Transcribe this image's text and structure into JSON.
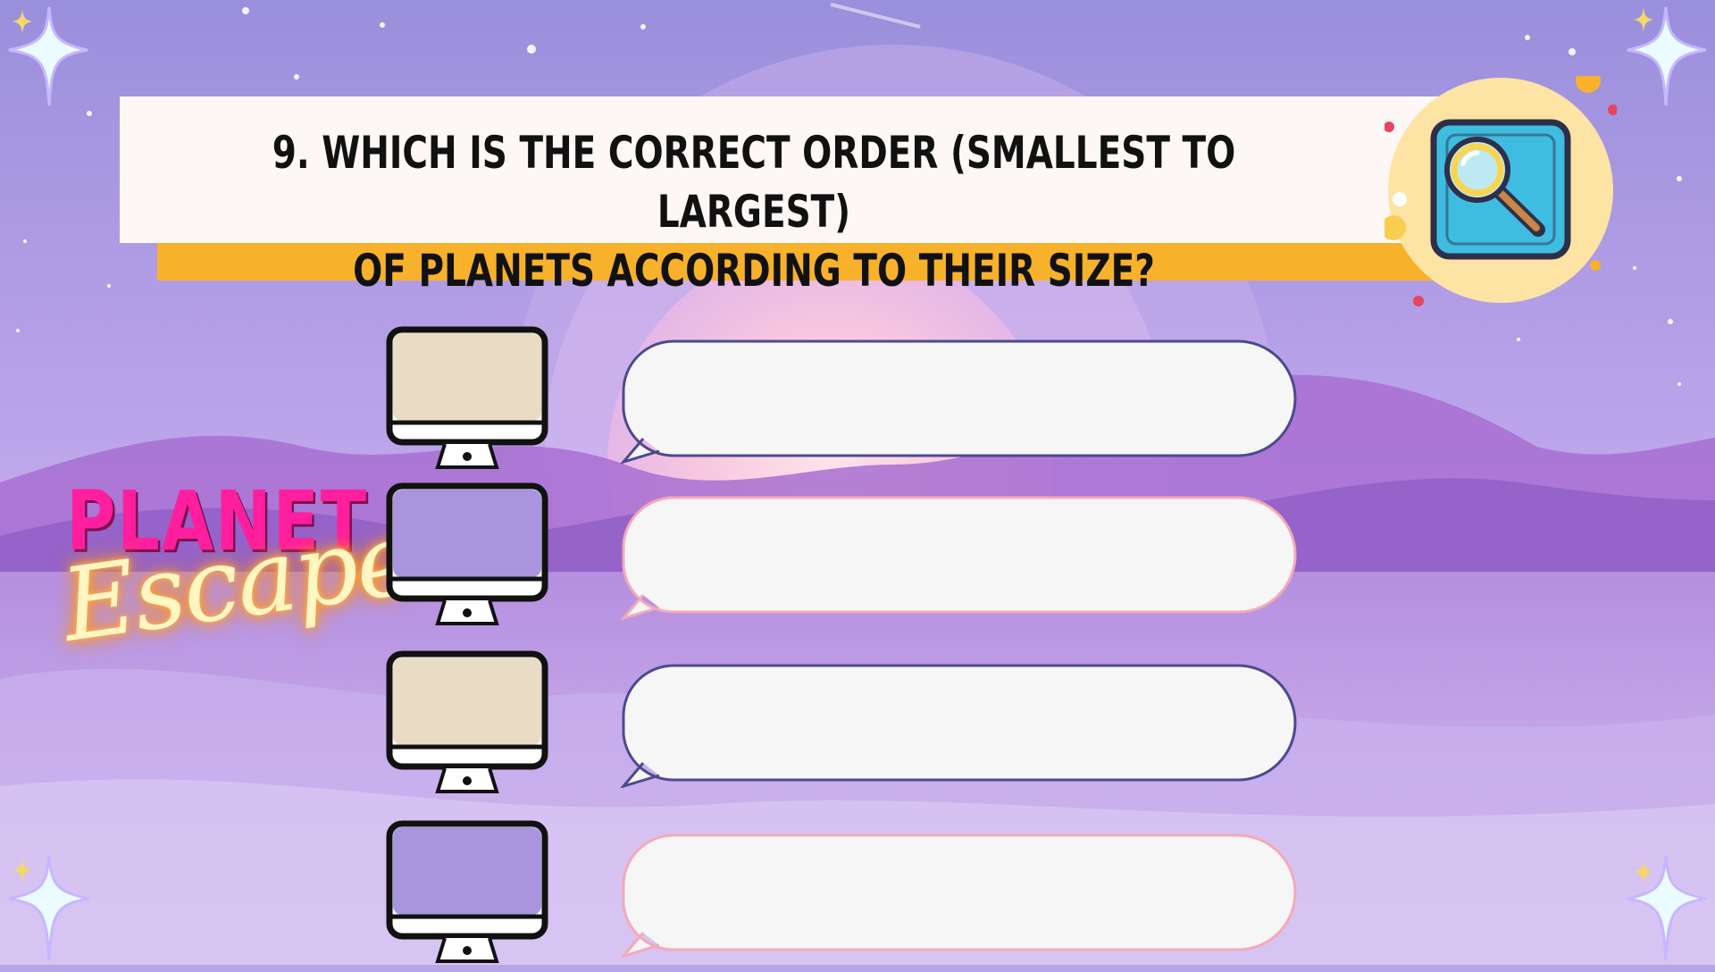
{
  "question": {
    "line1": "9. Which is the correct order (smallest to largest)",
    "line2": "of planets according to their size?"
  },
  "brand": {
    "title": "PLANET",
    "subtitle": "Escape"
  },
  "options": [
    {
      "answer": "",
      "screen_color": "#e9dcc5",
      "bubble_border": "#4c4a8e"
    },
    {
      "answer": "",
      "screen_color": "#a995dd",
      "bubble_border": "#f4a9b8"
    },
    {
      "answer": "",
      "screen_color": "#e9dcc5",
      "bubble_border": "#4c4a8e"
    },
    {
      "answer": "",
      "screen_color": "#a995dd",
      "bubble_border": "#f4a9b8"
    }
  ],
  "icons": {
    "badge": "magnifying-glass-icon",
    "decor": "sparkle-star-icon"
  },
  "colors": {
    "accent_bar": "#f7b12b",
    "title_pink": "#ff1f9e",
    "background": "#b7a6e6"
  }
}
